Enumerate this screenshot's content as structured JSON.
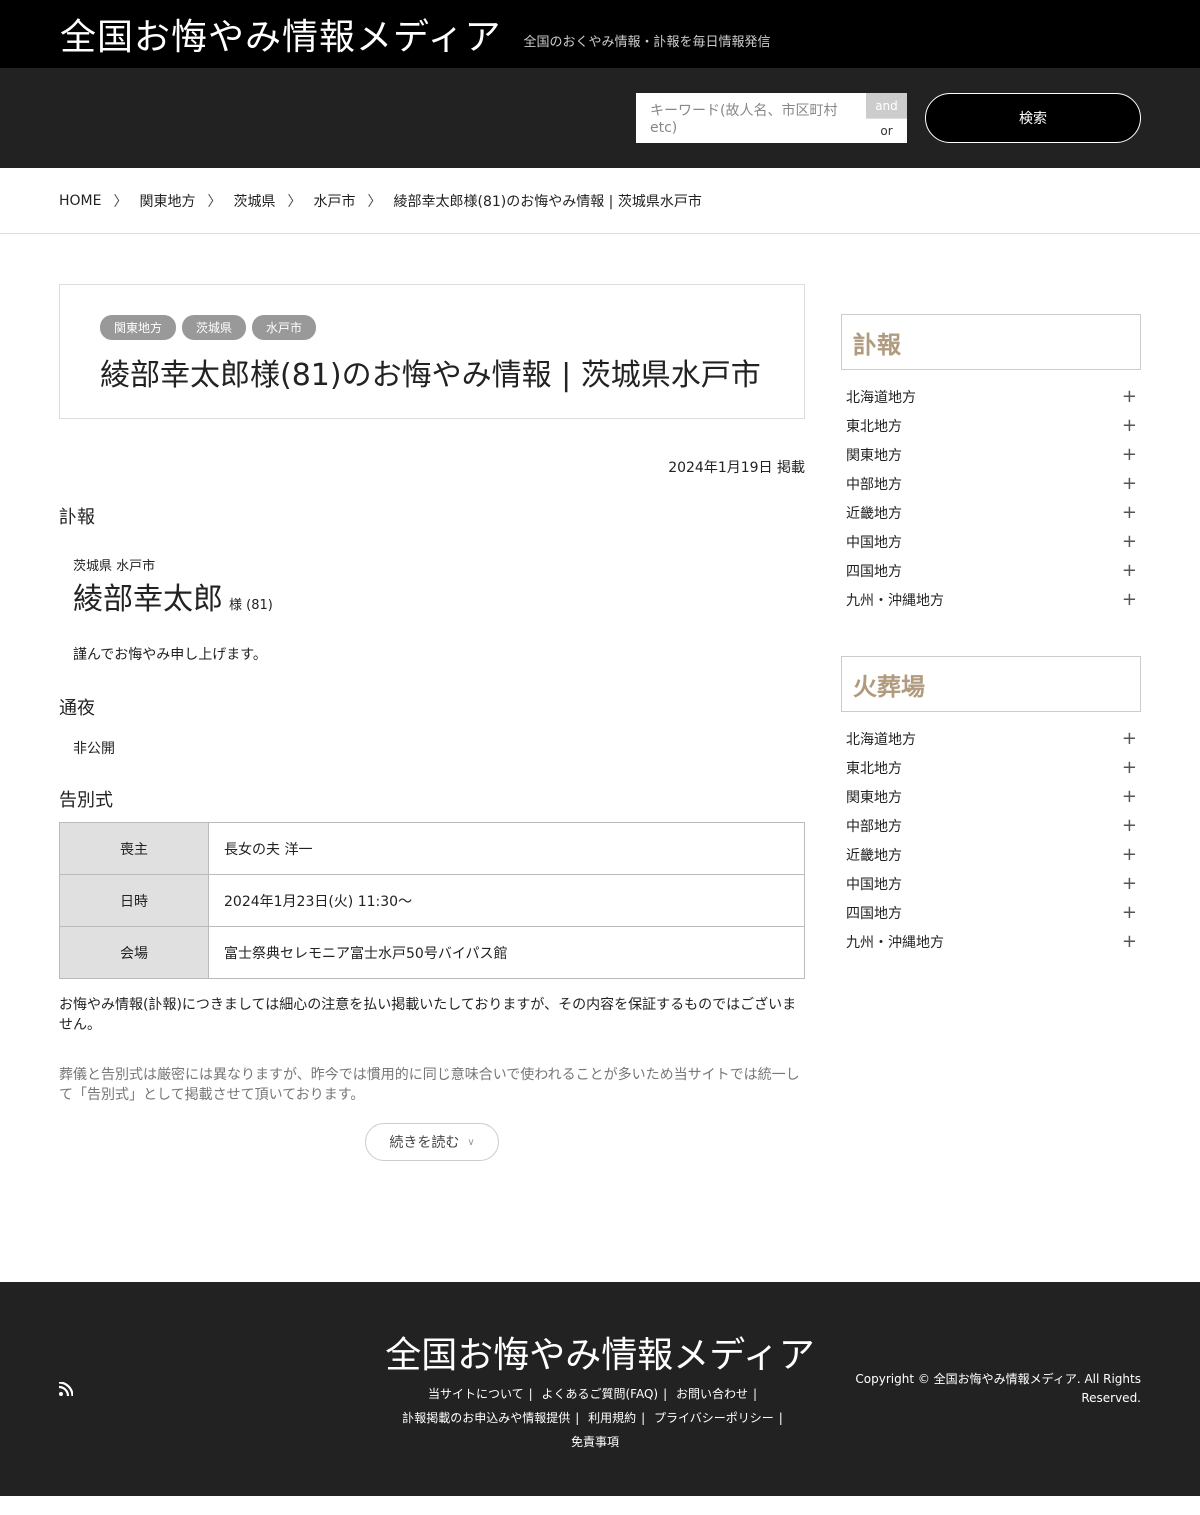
{
  "header": {
    "site_title": "全国お悔やみ情報メディア",
    "tagline": "全国のおくやみ情報・訃報を毎日情報発信"
  },
  "search": {
    "placeholder": "キーワード(故人名、市区町村etc)",
    "and_label": "and",
    "or_label": "or",
    "button_label": "検索"
  },
  "breadcrumb": [
    "HOME",
    "関東地方",
    "茨城県",
    "水戸市",
    "綾部幸太郎様(81)のお悔やみ情報 | 茨城県水戸市"
  ],
  "article": {
    "tags": [
      "関東地方",
      "茨城県",
      "水戸市"
    ],
    "title": "綾部幸太郎様(81)のお悔やみ情報 | 茨城県水戸市",
    "posted_date": "2024年1月19日 掲載",
    "fuho_heading": "訃報",
    "location": "茨城県 水戸市",
    "name": "綾部幸太郎",
    "suffix": "様 (81)",
    "condolence": "謹んでお悔やみ申し上げます。",
    "tsuya_heading": "通夜",
    "tsuya_value": "非公開",
    "funeral_heading": "告別式",
    "funeral_rows": [
      {
        "label": "喪主",
        "value": "長女の夫 洋一"
      },
      {
        "label": "日時",
        "value": "2024年1月23日(火) 11:30～"
      },
      {
        "label": "会場",
        "value": "富士祭典セレモニア富士水戸50号バイパス館"
      }
    ],
    "note1": "お悔やみ情報(訃報)につきましては細心の注意を払い掲載いたしておりますが、その内容を保証するものではございません。",
    "note2": "葬儀と告別式は厳密には異なりますが、昨今では慣用的に同じ意味合いで使われることが多いため当サイトでは統一して「告別式」として掲載させて頂いております。",
    "read_more": "続きを読む"
  },
  "sidebar": {
    "fuho_title": "訃報",
    "kasoba_title": "火葬場",
    "regions": [
      "北海道地方",
      "東北地方",
      "関東地方",
      "中部地方",
      "近畿地方",
      "中国地方",
      "四国地方",
      "九州・沖縄地方"
    ]
  },
  "footer": {
    "title": "全国お悔やみ情報メディア",
    "links": [
      "当サイトについて",
      "よくあるご質問(FAQ)",
      "お問い合わせ",
      "訃報掲載のお申込みや情報提供",
      "利用規約",
      "プライバシーポリシー",
      "免責事項"
    ],
    "copyright": "Copyright © 全国お悔やみ情報メディア. All Rights Reserved."
  }
}
